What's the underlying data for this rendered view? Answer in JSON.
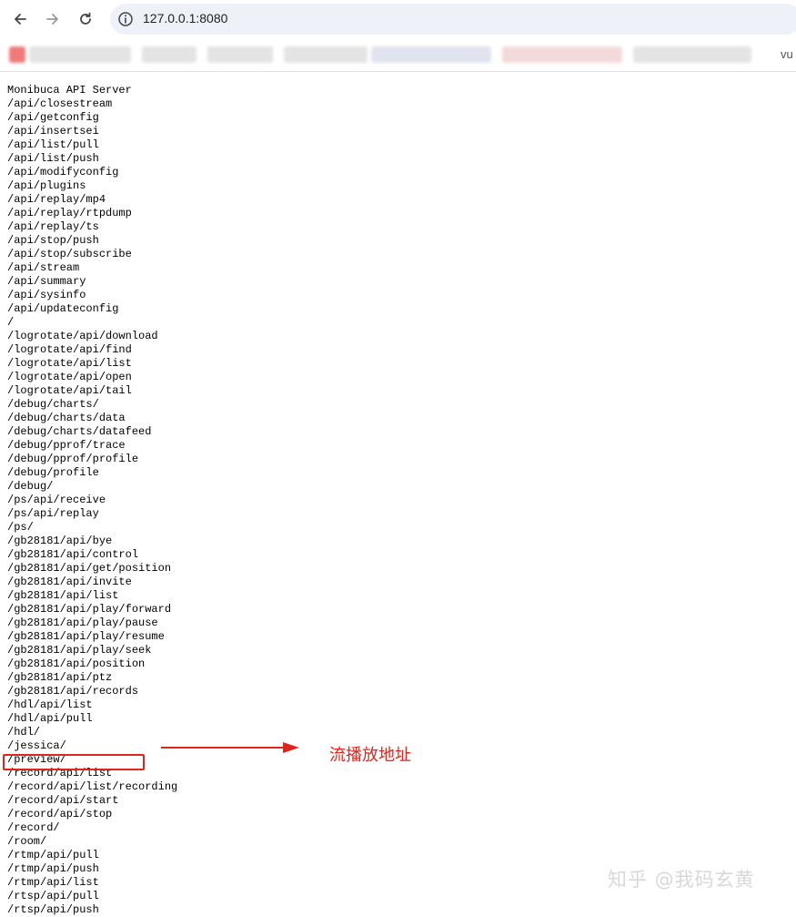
{
  "browser": {
    "url": "127.0.0.1:8080",
    "bookmarks_overflow_text": "vu"
  },
  "page": {
    "title_line": "Monibuca API Server",
    "routes": [
      "/api/closestream",
      "/api/getconfig",
      "/api/insertsei",
      "/api/list/pull",
      "/api/list/push",
      "/api/modifyconfig",
      "/api/plugins",
      "/api/replay/mp4",
      "/api/replay/rtpdump",
      "/api/replay/ts",
      "/api/stop/push",
      "/api/stop/subscribe",
      "/api/stream",
      "/api/summary",
      "/api/sysinfo",
      "/api/updateconfig",
      "/",
      "/logrotate/api/download",
      "/logrotate/api/find",
      "/logrotate/api/list",
      "/logrotate/api/open",
      "/logrotate/api/tail",
      "/debug/charts/",
      "/debug/charts/data",
      "/debug/charts/datafeed",
      "/debug/pprof/trace",
      "/debug/pprof/profile",
      "/debug/profile",
      "/debug/",
      "/ps/api/receive",
      "/ps/api/replay",
      "/ps/",
      "/gb28181/api/bye",
      "/gb28181/api/control",
      "/gb28181/api/get/position",
      "/gb28181/api/invite",
      "/gb28181/api/list",
      "/gb28181/api/play/forward",
      "/gb28181/api/play/pause",
      "/gb28181/api/play/resume",
      "/gb28181/api/play/seek",
      "/gb28181/api/position",
      "/gb28181/api/ptz",
      "/gb28181/api/records",
      "/hdl/api/list",
      "/hdl/api/pull",
      "/hdl/",
      "/jessica/",
      "/preview/",
      "/record/api/list",
      "/record/api/list/recording",
      "/record/api/start",
      "/record/api/stop",
      "/record/",
      "/room/",
      "/rtmp/api/pull",
      "/rtmp/api/push",
      "/rtmp/api/list",
      "/rtsp/api/pull",
      "/rtsp/api/push"
    ]
  },
  "annotation": {
    "label": "流播放地址",
    "color": "#e0251d"
  },
  "watermark": "知乎 @我码玄黄",
  "icons": {
    "back": "arrow-left-icon",
    "forward": "arrow-right-icon",
    "reload": "reload-icon",
    "site_info": "site-info-icon"
  }
}
